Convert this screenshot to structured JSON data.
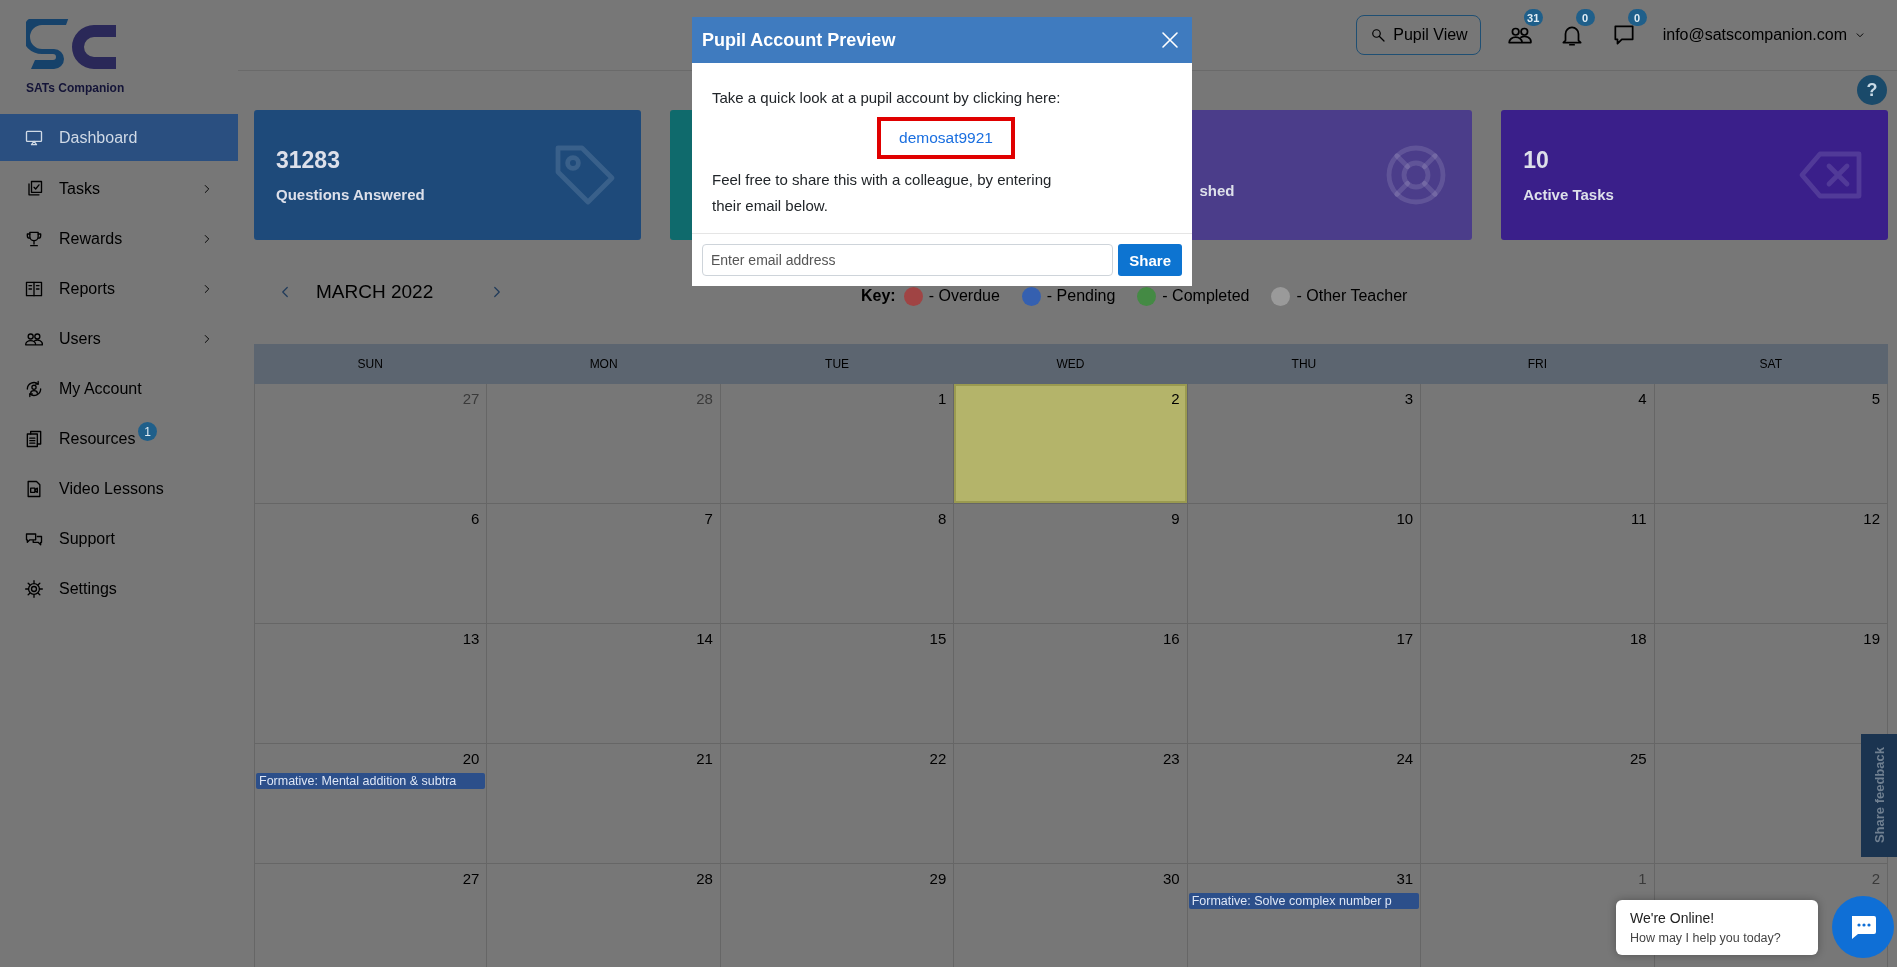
{
  "sidebar": {
    "logo_text": "SATs Companion",
    "items": [
      {
        "label": "Dashboard",
        "kind": "monitor",
        "selected": true,
        "submenu": false
      },
      {
        "label": "Tasks",
        "kind": "tasks",
        "selected": false,
        "submenu": true
      },
      {
        "label": "Rewards",
        "kind": "trophy",
        "selected": false,
        "submenu": true
      },
      {
        "label": "Reports",
        "kind": "reports",
        "selected": false,
        "submenu": true
      },
      {
        "label": "Users",
        "kind": "users",
        "selected": false,
        "submenu": true
      },
      {
        "label": "My Account",
        "kind": "account",
        "selected": false,
        "submenu": false
      },
      {
        "label": "Resources",
        "kind": "documents",
        "selected": false,
        "submenu": false,
        "badge": "1"
      },
      {
        "label": "Video Lessons",
        "kind": "video",
        "selected": false,
        "submenu": false
      },
      {
        "label": "Support",
        "kind": "support",
        "selected": false,
        "submenu": false
      },
      {
        "label": "Settings",
        "kind": "settings",
        "selected": false,
        "submenu": false
      }
    ]
  },
  "header": {
    "pupil_view_button": "Pupil View",
    "notifications": [
      {
        "kind": "users",
        "count": "31"
      },
      {
        "kind": "bell",
        "count": "0"
      },
      {
        "kind": "chat",
        "count": "0"
      }
    ],
    "account": "info@satscompanion.com",
    "help": "?"
  },
  "stats": [
    {
      "value": "31283",
      "label": "Questions Answered",
      "kind": "tag",
      "color": "#1e4a7a"
    },
    {
      "color": "#0f6a6c"
    },
    {
      "label": "shed",
      "kind": "lifebuoy",
      "color": "#4b3d8a",
      "covered": true
    },
    {
      "value": "10",
      "label": "Active Tasks",
      "kind": "backspace",
      "color": "#3a1f8a"
    }
  ],
  "calendar": {
    "month": "MARCH 2022",
    "key_label": "Key:",
    "key": [
      {
        "label": "- Overdue",
        "color": "#a04444"
      },
      {
        "label": "- Pending",
        "color": "#3560b0"
      },
      {
        "label": "- Completed",
        "color": "#448a44"
      },
      {
        "label": "- Other Teacher",
        "color": "#9a9a9a"
      }
    ],
    "weekdays": [
      "SUN",
      "MON",
      "TUE",
      "WED",
      "THU",
      "FRI",
      "SAT"
    ],
    "weeks": [
      [
        {
          "day": "27",
          "muted": true,
          "today": false
        },
        {
          "day": "28",
          "muted": true,
          "today": false
        },
        {
          "day": "1",
          "muted": false,
          "today": false
        },
        {
          "day": "2",
          "muted": false,
          "today": true
        },
        {
          "day": "3",
          "muted": false,
          "today": false
        },
        {
          "day": "4",
          "muted": false,
          "today": false
        },
        {
          "day": "5",
          "muted": false,
          "today": false
        }
      ],
      [
        {
          "day": "6",
          "muted": false,
          "today": false
        },
        {
          "day": "7",
          "muted": false,
          "today": false
        },
        {
          "day": "8",
          "muted": false,
          "today": false
        },
        {
          "day": "9",
          "muted": false,
          "today": false
        },
        {
          "day": "10",
          "muted": false,
          "today": false
        },
        {
          "day": "11",
          "muted": false,
          "today": false
        },
        {
          "day": "12",
          "muted": false,
          "today": false
        }
      ],
      [
        {
          "day": "13",
          "muted": false,
          "today": false
        },
        {
          "day": "14",
          "muted": false,
          "today": false
        },
        {
          "day": "15",
          "muted": false,
          "today": false
        },
        {
          "day": "16",
          "muted": false,
          "today": false
        },
        {
          "day": "17",
          "muted": false,
          "today": false
        },
        {
          "day": "18",
          "muted": false,
          "today": false
        },
        {
          "day": "19",
          "muted": false,
          "today": false
        }
      ],
      [
        {
          "day": "20",
          "muted": false,
          "today": false,
          "events": [
            "Formative: Mental addition & subtra"
          ]
        },
        {
          "day": "21",
          "muted": false,
          "today": false
        },
        {
          "day": "22",
          "muted": false,
          "today": false
        },
        {
          "day": "23",
          "muted": false,
          "today": false
        },
        {
          "day": "24",
          "muted": false,
          "today": false
        },
        {
          "day": "25",
          "muted": false,
          "today": false
        },
        {
          "today": false
        }
      ],
      [
        {
          "day": "27",
          "muted": false,
          "today": false
        },
        {
          "day": "28",
          "muted": false,
          "today": false
        },
        {
          "day": "29",
          "muted": false,
          "today": false
        },
        {
          "day": "30",
          "muted": false,
          "today": false
        },
        {
          "day": "31",
          "muted": false,
          "today": false,
          "events": [
            "Formative: Solve complex number p"
          ]
        },
        {
          "day": "1",
          "muted": true,
          "today": false
        },
        {
          "day": "2",
          "muted": true,
          "today": false
        }
      ]
    ]
  },
  "modal": {
    "title": "Pupil Account Preview",
    "intro": "Take a quick look at a pupil account by clicking here:",
    "link": "demosat9921",
    "share_text": "Feel free to share this with a colleague, by entering their email below.",
    "email_placeholder": "Enter email address",
    "share_button": "Share"
  },
  "feedback_tab": "Share feedback",
  "chat": {
    "title": "We're Online!",
    "subtitle": "How may I help you today?"
  }
}
